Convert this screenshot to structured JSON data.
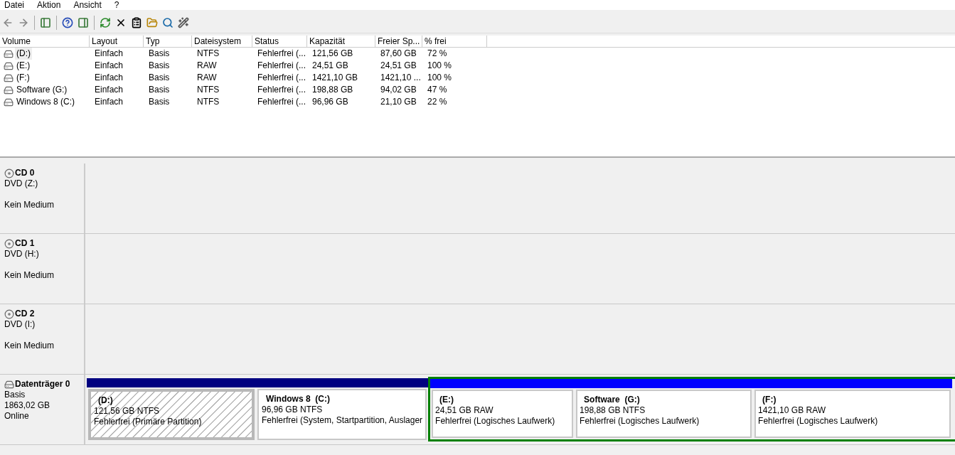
{
  "menu": [
    "Datei",
    "Aktion",
    "Ansicht",
    "?"
  ],
  "volume_table": {
    "columns": [
      "Volume",
      "Layout",
      "Typ",
      "Dateisystem",
      "Status",
      "Kapazität",
      "Freier Sp...",
      "% frei"
    ],
    "rows": [
      {
        "selected": true,
        "cells": [
          "(D:)",
          "Einfach",
          "Basis",
          "NTFS",
          "Fehlerfrei (...",
          "121,56 GB",
          "87,60 GB",
          "72 %"
        ]
      },
      {
        "selected": false,
        "cells": [
          "(E:)",
          "Einfach",
          "Basis",
          "RAW",
          "Fehlerfrei (...",
          "24,51 GB",
          "24,51 GB",
          "100 %"
        ]
      },
      {
        "selected": false,
        "cells": [
          "(F:)",
          "Einfach",
          "Basis",
          "RAW",
          "Fehlerfrei (...",
          "1421,10 GB",
          "1421,10 ...",
          "100 %"
        ]
      },
      {
        "selected": false,
        "cells": [
          "Software (G:)",
          "Einfach",
          "Basis",
          "NTFS",
          "Fehlerfrei (...",
          "198,88 GB",
          "94,02 GB",
          "47 %"
        ]
      },
      {
        "selected": false,
        "cells": [
          "Windows 8 (C:)",
          "Einfach",
          "Basis",
          "NTFS",
          "Fehlerfrei (...",
          "96,96 GB",
          "21,10 GB",
          "22 %"
        ]
      }
    ]
  },
  "disks": [
    {
      "kind": "cd",
      "name": "CD 0",
      "lines": [
        "DVD (Z:)",
        "Kein Medium"
      ]
    },
    {
      "kind": "cd",
      "name": "CD 1",
      "lines": [
        "DVD (H:)",
        "Kein Medium"
      ]
    },
    {
      "kind": "cd",
      "name": "CD 2",
      "lines": [
        "DVD (I:)",
        "Kein Medium"
      ]
    },
    {
      "kind": "disk",
      "name": "Datenträger 0",
      "lines": [
        "Basis",
        "1863,02 GB",
        "Online"
      ],
      "partitions": [
        {
          "kind": "primary",
          "selected": true,
          "color": "#000080",
          "title": "(D:)",
          "size": "121,56 GB NTFS",
          "status": "Fehlerfrei (Primäre Partition)"
        },
        {
          "kind": "primary",
          "selected": false,
          "color": "#000080",
          "title": "Windows 8  (C:)",
          "size": "96,96 GB NTFS",
          "status": "Fehlerfrei (System, Startpartition, Auslager"
        },
        {
          "kind": "extended",
          "color": "#008000",
          "children": [
            {
              "kind": "logical",
              "selected": false,
              "color": "#0000ff",
              "title": "(E:)",
              "size": "24,51 GB RAW",
              "status": "Fehlerfrei (Logisches Laufwerk)"
            },
            {
              "kind": "logical",
              "selected": false,
              "color": "#0000ff",
              "title": "Software  (G:)",
              "size": "198,88 GB NTFS",
              "status": "Fehlerfrei (Logisches Laufwerk)"
            },
            {
              "kind": "logical",
              "selected": false,
              "color": "#0000ff",
              "title": "(F:)",
              "size": "1421,10 GB RAW",
              "status": "Fehlerfrei (Logisches Laufwerk)"
            }
          ]
        }
      ]
    }
  ]
}
